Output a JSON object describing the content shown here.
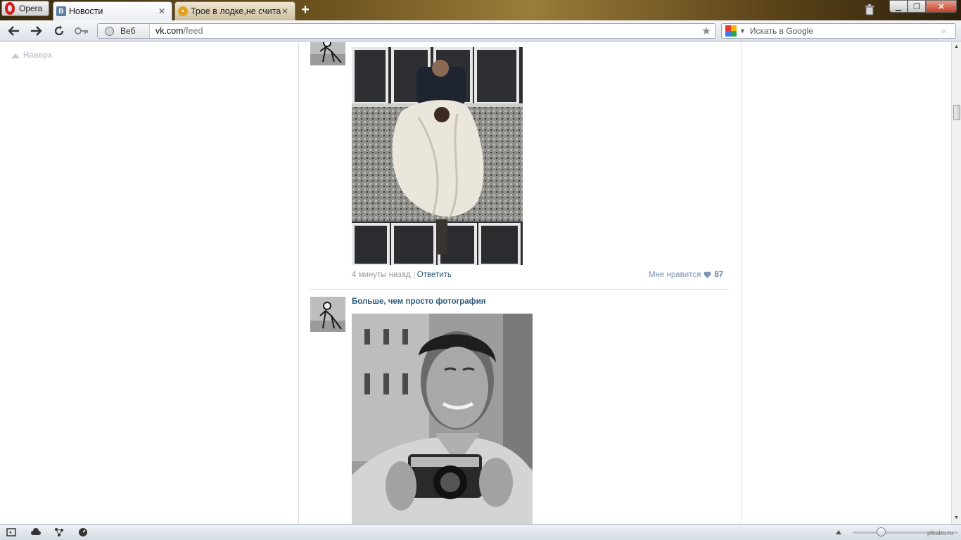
{
  "browser": {
    "menu_label": "Opera",
    "tabs": [
      {
        "label": "Новости",
        "favicon": "vk-favicon",
        "active": true
      },
      {
        "label": "Трое в лодке,не счита...",
        "favicon": "pikabu-favicon",
        "active": false
      }
    ],
    "address": {
      "mode_label": "Веб",
      "url_host": "vk.com",
      "url_path": "/feed"
    },
    "search": {
      "placeholder": "Искать в Google"
    }
  },
  "page": {
    "to_top_label": "Наверх",
    "posts": [
      {
        "time": "4 минуты назад",
        "reply_label": "Ответить",
        "like_label": "Мне нравится",
        "like_count": "87"
      },
      {
        "author": "Больше, чем просто фотография"
      }
    ]
  },
  "status": {
    "watermark": "pikabu.ru"
  },
  "colors": {
    "vk_link": "#2b587a",
    "like_blue": "#5b7fa6",
    "muted": "#999999"
  }
}
